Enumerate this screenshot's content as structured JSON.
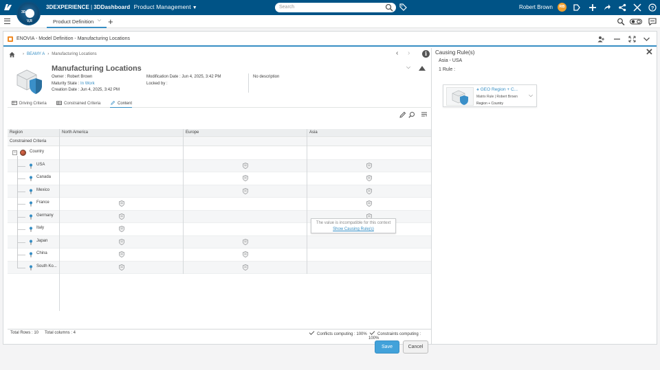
{
  "topbar": {
    "brand_platform": "3DEXPERIENCE",
    "brand_separator": "|",
    "brand_dashboard": "3DDashboard",
    "app_name": "Product Management",
    "compass_top": "3D",
    "compass_bottom": "V,R",
    "search_placeholder": "Search",
    "user_name": "Robert Brown",
    "user_initials": "RB"
  },
  "tabbar": {
    "tab_label": "Product Definition"
  },
  "widget": {
    "title": "ENOVIA - Model Definition - Manufacturing Locations"
  },
  "breadcrumb": {
    "parent": "BEAMY A",
    "current": "Manufacturing Locations"
  },
  "object": {
    "title": "Manufacturing Locations",
    "owner": "Owner : Robert Brown",
    "maturity_label": "Maturity State :",
    "maturity_value": "In Work",
    "creation": "Creation Date : Jun 4, 2025, 3:42 PM",
    "modification": "Modification Date : Jun 4, 2025, 3:42 PM",
    "locked": "Locked by :",
    "description": "No description"
  },
  "subtabs": [
    "Driving Criteria",
    "Constrained Criteria",
    "Content"
  ],
  "grid": {
    "header_region": "Region",
    "columns": [
      "North America",
      "Europe",
      "Asia"
    ],
    "header_constrained": "Constrained Criteria",
    "root_label": "Country",
    "rows": [
      {
        "name": "USA",
        "na": false,
        "eu": true,
        "asia": true
      },
      {
        "name": "Canada",
        "na": false,
        "eu": true,
        "asia": true
      },
      {
        "name": "Mexico",
        "na": false,
        "eu": true,
        "asia": true
      },
      {
        "name": "France",
        "na": true,
        "eu": false,
        "asia": true
      },
      {
        "name": "Germany",
        "na": true,
        "eu": false,
        "asia": true
      },
      {
        "name": "Italy",
        "na": true,
        "eu": false,
        "asia": true
      },
      {
        "name": "Japan",
        "na": true,
        "eu": true,
        "asia": false
      },
      {
        "name": "China",
        "na": true,
        "eu": true,
        "asia": false
      },
      {
        "name": "South Ko...",
        "na": true,
        "eu": true,
        "asia": false
      }
    ],
    "tooltip_text": "The value is incompatible for this context",
    "tooltip_link": "Show Causing Rule(s)"
  },
  "footer": {
    "total_rows": "Total Rows : 10",
    "total_columns": "Total columns : 4",
    "conflicts": "Conflicts computing : 100%",
    "constraints": "Constraints computing : 100%",
    "save": "Save",
    "cancel": "Cancel"
  },
  "causing_rules": {
    "title": "Causing Rule(s)",
    "context": "Asia - USA",
    "count": "1 Rule :",
    "rule_title": "GEO Region + C...",
    "rule_meta": "Matrix Rule | Robert Brown",
    "rule_tags": "Region + Country"
  },
  "colors": {
    "topbar": "#005386",
    "accent": "#368ec4",
    "save_button": "#42a2da"
  }
}
